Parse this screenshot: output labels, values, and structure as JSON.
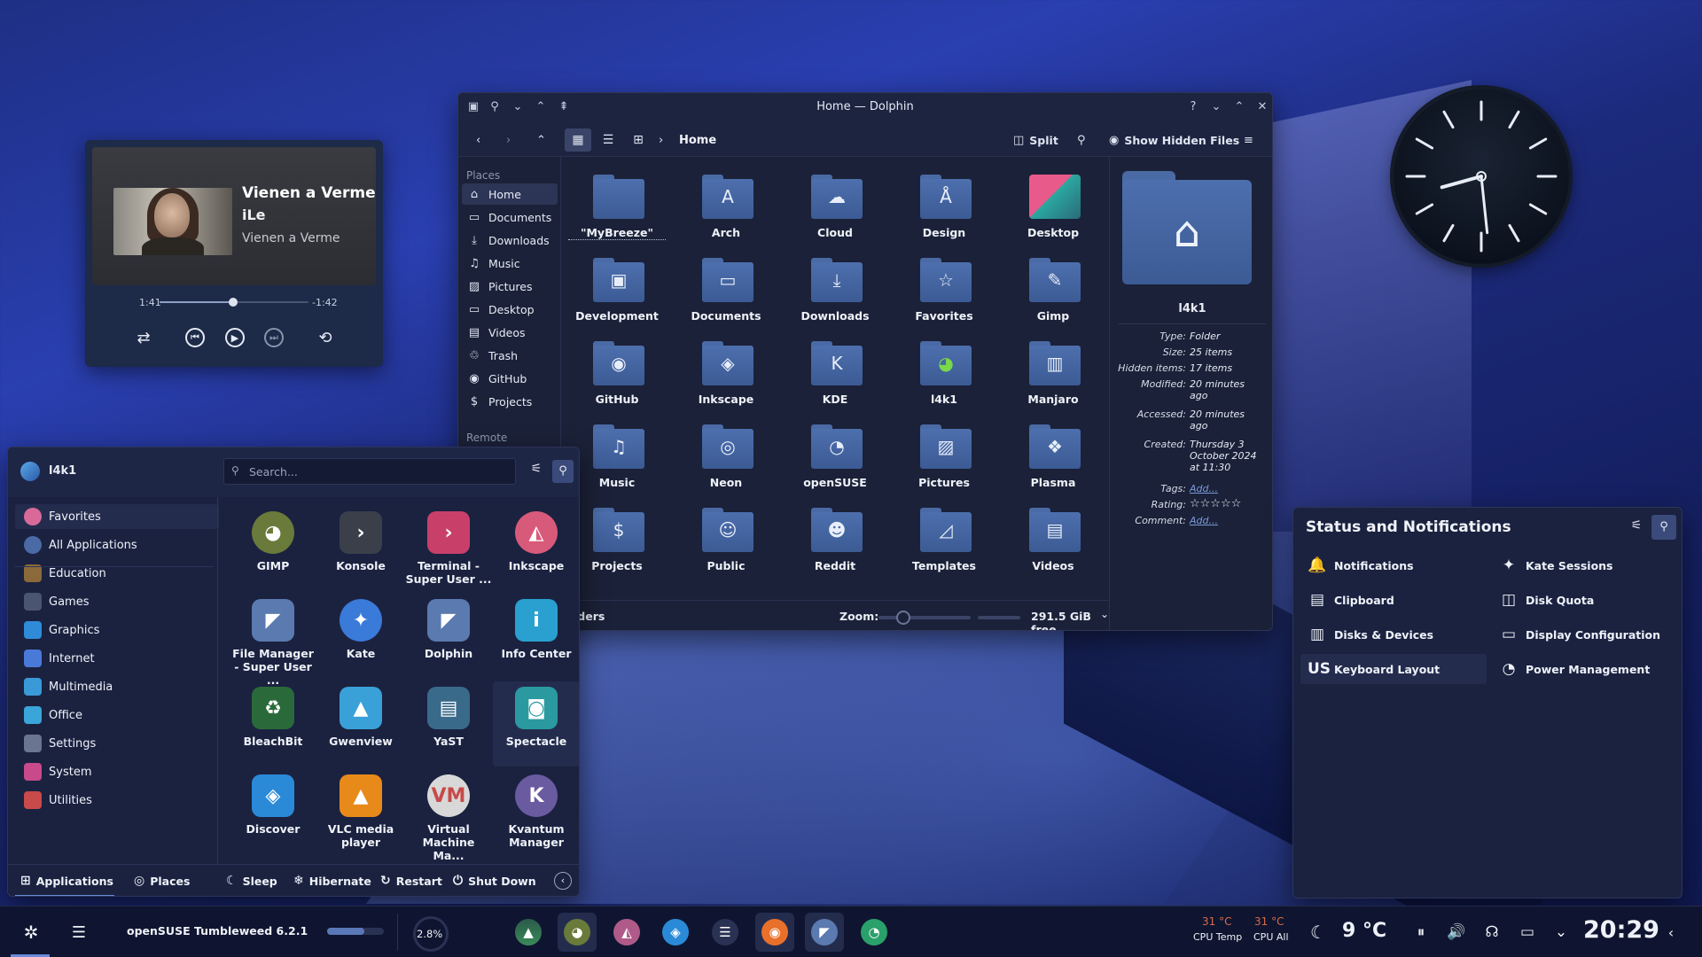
{
  "media_player": {
    "title": "Vienen a Verme",
    "artist": "iLe",
    "album": "Vienen a Verme",
    "elapsed": "1:41",
    "remaining": "-1:42",
    "progress": 0.49
  },
  "dolphin": {
    "window_title": "Home — Dolphin",
    "breadcrumb": "Home",
    "split_label": "Split",
    "show_hidden_label": "Show Hidden Files",
    "places_header": "Places",
    "remote_header": "Remote",
    "places": [
      {
        "label": "Home",
        "icon": "home-icon"
      },
      {
        "label": "Documents",
        "icon": "document-icon"
      },
      {
        "label": "Downloads",
        "icon": "download-icon"
      },
      {
        "label": "Music",
        "icon": "music-icon"
      },
      {
        "label": "Pictures",
        "icon": "picture-icon"
      },
      {
        "label": "Desktop",
        "icon": "desktop-icon"
      },
      {
        "label": "Videos",
        "icon": "video-icon"
      },
      {
        "label": "Trash",
        "icon": "trash-icon"
      },
      {
        "label": "GitHub",
        "icon": "github-icon"
      },
      {
        "label": "Projects",
        "icon": "dollar-icon"
      }
    ],
    "folders": [
      {
        "name": "\"MyBreeze\"",
        "glyph": ""
      },
      {
        "name": "Arch",
        "glyph": "A"
      },
      {
        "name": "Cloud",
        "glyph": "☁"
      },
      {
        "name": "Design",
        "glyph": "Å"
      },
      {
        "name": "Desktop",
        "glyph": ""
      },
      {
        "name": "Development",
        "glyph": "▣"
      },
      {
        "name": "Documents",
        "glyph": "▭"
      },
      {
        "name": "Downloads",
        "glyph": "⤓"
      },
      {
        "name": "Favorites",
        "glyph": "☆"
      },
      {
        "name": "Gimp",
        "glyph": "✎"
      },
      {
        "name": "GitHub",
        "glyph": "◉"
      },
      {
        "name": "Inkscape",
        "glyph": "◈"
      },
      {
        "name": "KDE",
        "glyph": "K"
      },
      {
        "name": "l4k1",
        "glyph": ""
      },
      {
        "name": "Manjaro",
        "glyph": "▥"
      },
      {
        "name": "Music",
        "glyph": "♫"
      },
      {
        "name": "Neon",
        "glyph": "◎"
      },
      {
        "name": "openSUSE",
        "glyph": "◔"
      },
      {
        "name": "Pictures",
        "glyph": "▨"
      },
      {
        "name": "Plasma",
        "glyph": "❖"
      },
      {
        "name": "Projects",
        "glyph": "$"
      },
      {
        "name": "Public",
        "glyph": "☺"
      },
      {
        "name": "Reddit",
        "glyph": "☻"
      },
      {
        "name": "Templates",
        "glyph": "◿"
      },
      {
        "name": "Videos",
        "glyph": "▤"
      }
    ],
    "status_text": "folders",
    "zoom_label": "Zoom:",
    "free_space": "291.5 GiB free",
    "info": {
      "name": "l4k1",
      "type_key": "Type:",
      "type": "Folder",
      "size_key": "Size:",
      "size": "25 items",
      "hidden_key": "Hidden items:",
      "hidden": "17 items",
      "modified_key": "Modified:",
      "modified": "20 minutes ago",
      "accessed_key": "Accessed:",
      "accessed": "20 minutes ago",
      "created_key": "Created:",
      "created": "Thursday 3 October 2024 at 11:30",
      "tags_key": "Tags:",
      "tags": "Add...",
      "rating_key": "Rating:",
      "rating": "☆☆☆☆☆",
      "comment_key": "Comment:",
      "comment": "Add..."
    }
  },
  "launcher": {
    "user": "l4k1",
    "search_placeholder": "Search...",
    "categories": [
      {
        "label": "Favorites",
        "color": "#d86a9a"
      },
      {
        "label": "All Applications",
        "color": "#4a6aa5"
      },
      {
        "label": "Education",
        "color": "#8a6a3a"
      },
      {
        "label": "Games",
        "color": "#4a5570"
      },
      {
        "label": "Graphics",
        "color": "#2f8bd8"
      },
      {
        "label": "Internet",
        "color": "#4a7ad8"
      },
      {
        "label": "Multimedia",
        "color": "#3a9ad8"
      },
      {
        "label": "Office",
        "color": "#3aa5d8"
      },
      {
        "label": "Settings",
        "color": "#6a7590"
      },
      {
        "label": "System",
        "color": "#c84a8a"
      },
      {
        "label": "Utilities",
        "color": "#c84a4a"
      }
    ],
    "apps": [
      {
        "name": "GIMP",
        "color": "#6a7a3a",
        "glyph": "◕"
      },
      {
        "name": "Konsole",
        "color": "#3a3f4a",
        "glyph": "›"
      },
      {
        "name": "Terminal - Super User ...",
        "color": "#c8406a",
        "glyph": "›"
      },
      {
        "name": "Inkscape",
        "color": "#d85a7a",
        "glyph": "◭"
      },
      {
        "name": "File Manager - Super User ...",
        "color": "#5a7ab0",
        "glyph": "◤"
      },
      {
        "name": "Kate",
        "color": "#3a7ad8",
        "glyph": "✦"
      },
      {
        "name": "Dolphin",
        "color": "#5a7ab0",
        "glyph": "◤"
      },
      {
        "name": "Info Center",
        "color": "#2aa0d0",
        "glyph": "i"
      },
      {
        "name": "BleachBit",
        "color": "#2a6a3a",
        "glyph": "♻"
      },
      {
        "name": "Gwenview",
        "color": "#3aa0d8",
        "glyph": "▲"
      },
      {
        "name": "YaST",
        "color": "#3a6a8a",
        "glyph": "▤"
      },
      {
        "name": "Spectacle",
        "color": "#2a9aa0",
        "glyph": "◙"
      },
      {
        "name": "Discover",
        "color": "#2a8ad8",
        "glyph": "◈"
      },
      {
        "name": "VLC media player",
        "color": "#e88a1a",
        "glyph": "▲"
      },
      {
        "name": "Virtual Machine Ma...",
        "color": "#d8d8d8",
        "glyph": "VM"
      },
      {
        "name": "Kvantum Manager",
        "color": "#6a5aa0",
        "glyph": "K"
      }
    ],
    "footer": [
      {
        "label": "Applications",
        "icon": "grid-icon"
      },
      {
        "label": "Places",
        "icon": "compass-icon"
      },
      {
        "label": "Sleep",
        "icon": "sleep-icon"
      },
      {
        "label": "Hibernate",
        "icon": "snowflake-icon"
      },
      {
        "label": "Restart",
        "icon": "restart-icon"
      },
      {
        "label": "Shut Down",
        "icon": "power-icon"
      }
    ]
  },
  "status_panel": {
    "title": "Status and Notifications",
    "items": [
      {
        "label": "Notifications",
        "icon": "bell-icon"
      },
      {
        "label": "Kate Sessions",
        "icon": "kate-icon"
      },
      {
        "label": "Clipboard",
        "icon": "clipboard-icon"
      },
      {
        "label": "Disk Quota",
        "icon": "disk-quota-icon"
      },
      {
        "label": "Disks & Devices",
        "icon": "disk-icon"
      },
      {
        "label": "Display Configuration",
        "icon": "monitor-icon"
      },
      {
        "label": "Keyboard Layout",
        "icon": "keyboard-layout-icon"
      },
      {
        "label": "Power Management",
        "icon": "power-management-icon"
      }
    ],
    "keyboard_layout_code": "US"
  },
  "panel": {
    "os_label": "openSUSE Tumbleweed 6.2.1",
    "cpu_percent": "2.8%",
    "cpu_temp": "31 °C",
    "cpu_temp_label": "CPU Temp",
    "cpu_all": "31 °C",
    "cpu_all_label": "CPU All",
    "weather": "9 °C",
    "clock": "20:29",
    "os_bar_fill": 0.65,
    "accent": "#3d5a9e"
  }
}
